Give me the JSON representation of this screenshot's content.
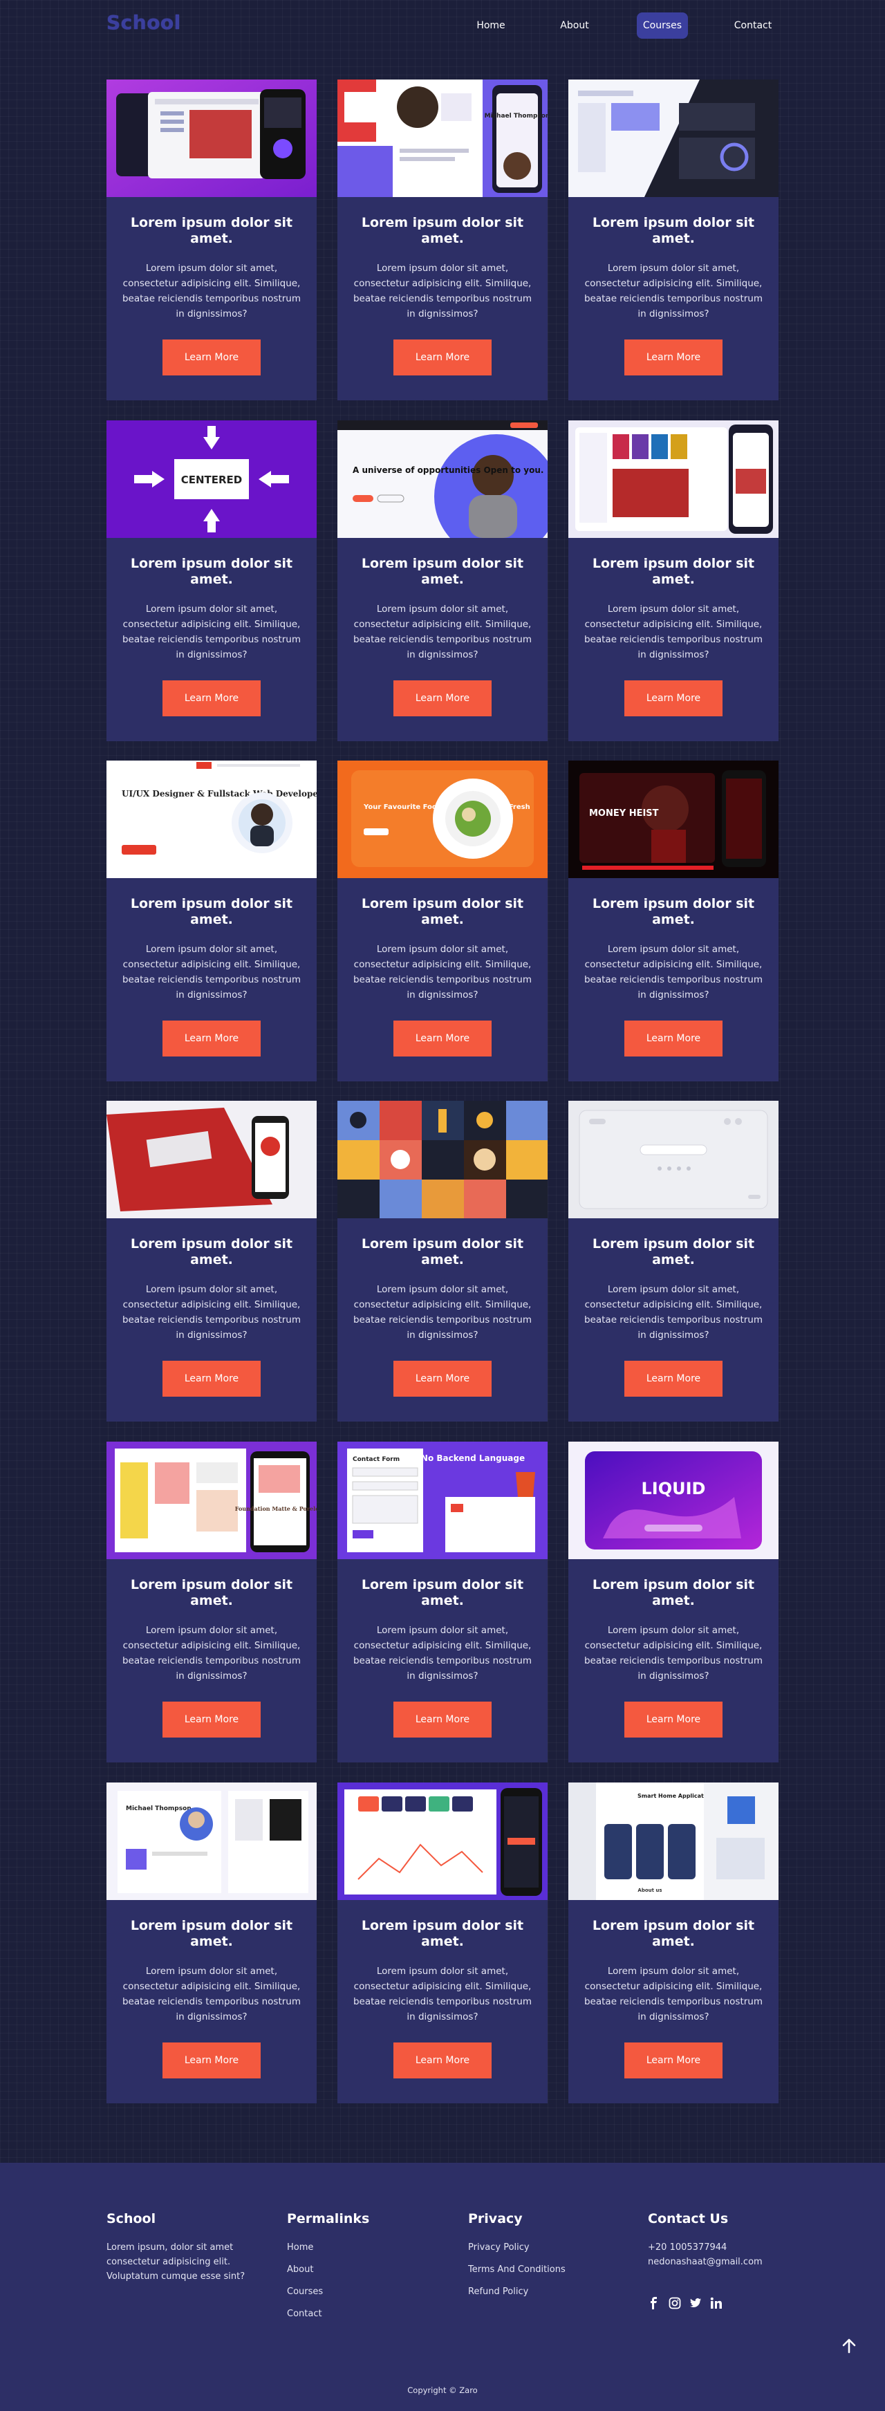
{
  "brand": "School",
  "nav": {
    "items": [
      {
        "label": "Home",
        "active": false
      },
      {
        "label": "About",
        "active": false
      },
      {
        "label": "Courses",
        "active": true
      },
      {
        "label": "Contact",
        "active": false
      }
    ]
  },
  "card_text": {
    "title": "Lorem ipsum dolor sit amet.",
    "body": "Lorem ipsum dolor sit amet, consectetur adipisicing elit. Similique, beatae reiciendis temporibus nostrum in dignissimos?",
    "button": "Learn More"
  },
  "thumbnails": {
    "centered_label": "CENTERED",
    "universe_text": "A universe of opportunities Open to you.",
    "ux_title": "UI/UX Designer & Fullstack Web Developer",
    "food_title": "Your Favourite Food Delivered Hot & Fresh",
    "money_heist": "MONEY HEIST",
    "contact_form": "Contact Form",
    "no_backend": "No Backend Language",
    "liquid": "LIQUID",
    "smart_home": "Smart Home Application",
    "michael": "Michael Thompson",
    "foundation": "Foundation Matte & Poreless",
    "about_us": "About us"
  },
  "footer": {
    "school": {
      "heading": "School",
      "text": "Lorem ipsum, dolor sit amet consectetur adipisicing elit. Voluptatum cumque esse sint?"
    },
    "permalinks": {
      "heading": "Permalinks",
      "links": [
        "Home",
        "About",
        "Courses",
        "Contact"
      ]
    },
    "privacy": {
      "heading": "Privacy",
      "links": [
        "Privacy Policy",
        "Terms And Conditions",
        "Refund Policy"
      ]
    },
    "contact": {
      "heading": "Contact Us",
      "phone": "+20 1005377944",
      "email": "nedonashaat@gmail.com"
    },
    "copyright": "Copyright © Zaro"
  },
  "colors": {
    "background": "#1c1f3a",
    "card": "#2d2f66",
    "accent": "#f4593f",
    "nav_active": "#3b3f9e"
  },
  "icons": [
    "facebook-icon",
    "instagram-icon",
    "twitter-icon",
    "linkedin-icon",
    "arrow-up-icon"
  ]
}
